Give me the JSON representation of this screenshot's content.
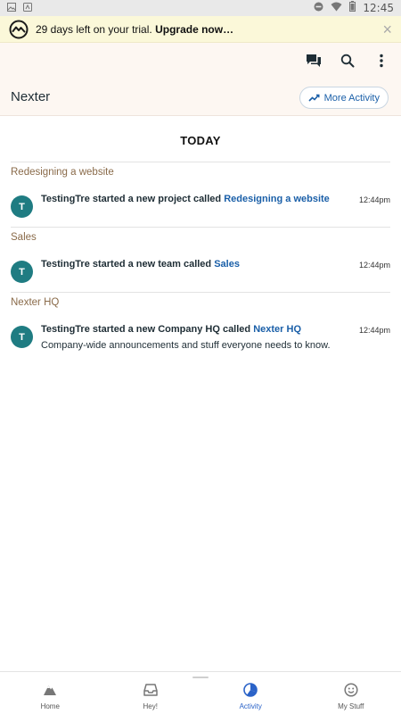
{
  "status_bar": {
    "time": "12:45"
  },
  "trial_banner": {
    "text": "29 days left on your trial.",
    "link": "Upgrade now…"
  },
  "header": {
    "title": "Nexter",
    "more_activity_label": "More Activity"
  },
  "feed": {
    "heading": "TODAY",
    "sections": [
      {
        "title": "Redesigning a website",
        "item": {
          "avatar": "T",
          "text": "TestingTre started a new project called ",
          "link": "Redesigning a website",
          "time": "12:44pm"
        }
      },
      {
        "title": "Sales",
        "item": {
          "avatar": "T",
          "text": "TestingTre started a new team called ",
          "link": "Sales",
          "time": "12:44pm"
        }
      },
      {
        "title": "Nexter HQ",
        "item": {
          "avatar": "T",
          "text": "TestingTre started a new Company HQ called ",
          "link": "Nexter HQ",
          "time": "12:44pm",
          "subtext": "Company-wide announcements and stuff everyone needs to know."
        }
      }
    ]
  },
  "bottom_nav": {
    "items": [
      {
        "label": "Home",
        "icon": "home-mountain-icon"
      },
      {
        "label": "Hey!",
        "icon": "inbox-tray-icon"
      },
      {
        "label": "Activity",
        "icon": "activity-pie-icon",
        "active": true
      },
      {
        "label": "My Stuff",
        "icon": "smiley-face-icon"
      }
    ]
  },
  "colors": {
    "link": "#1a5fa8",
    "avatar": "#1f7c82",
    "active_nav": "#2b63c8",
    "section_title": "#8a6b4a",
    "trial_bg": "#fbf8d9",
    "header_bg": "#fdf7f2"
  }
}
